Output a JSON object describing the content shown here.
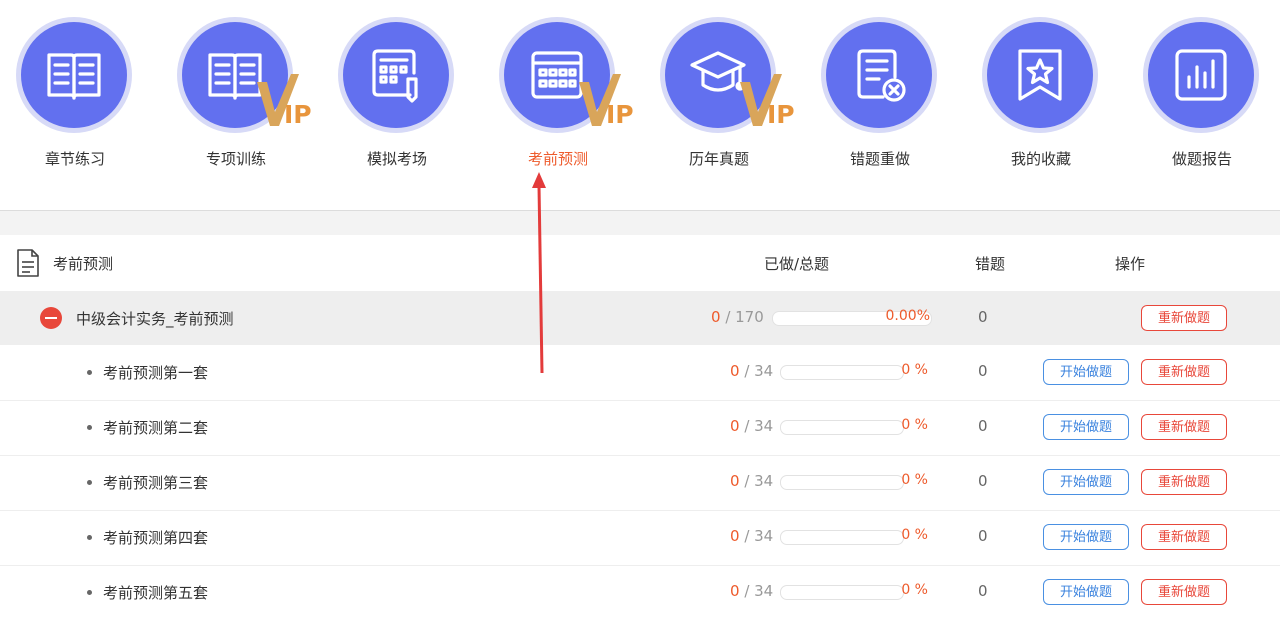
{
  "nav": {
    "items": [
      {
        "id": "chapter",
        "label": "章节练习",
        "icon": "book-icon",
        "vip": false,
        "active": false
      },
      {
        "id": "special",
        "label": "专项训练",
        "icon": "book-icon",
        "vip": true,
        "active": false
      },
      {
        "id": "mock",
        "label": "模拟考场",
        "icon": "exam-paper-icon",
        "vip": false,
        "active": false
      },
      {
        "id": "predict",
        "label": "考前预测",
        "icon": "calendar-grid-icon",
        "vip": true,
        "active": true
      },
      {
        "id": "past",
        "label": "历年真题",
        "icon": "graduation-cap-icon",
        "vip": true,
        "active": false
      },
      {
        "id": "redo",
        "label": "错题重做",
        "icon": "error-doc-icon",
        "vip": false,
        "active": false
      },
      {
        "id": "fav",
        "label": "我的收藏",
        "icon": "star-bookmark-icon",
        "vip": false,
        "active": false
      },
      {
        "id": "report",
        "label": "做题报告",
        "icon": "bar-chart-icon",
        "vip": false,
        "active": false
      }
    ],
    "vip_text": "IP"
  },
  "table": {
    "headers": {
      "name": "考前预测",
      "progress": "已做/总题",
      "wrong": "错题",
      "action": "操作"
    },
    "parent": {
      "name": "中级会计实务_考前预测",
      "done": "0",
      "total": "170",
      "percent": "0.00%",
      "progress": 0,
      "wrong": "0",
      "redo_label": "重新做题"
    },
    "children": [
      {
        "name": "考前预测第一套",
        "done": "0",
        "total": "34",
        "percent": "0 %",
        "progress": 0,
        "wrong": "0",
        "start_label": "开始做题",
        "redo_label": "重新做题"
      },
      {
        "name": "考前预测第二套",
        "done": "0",
        "total": "34",
        "percent": "0 %",
        "progress": 0,
        "wrong": "0",
        "start_label": "开始做题",
        "redo_label": "重新做题"
      },
      {
        "name": "考前预测第三套",
        "done": "0",
        "total": "34",
        "percent": "0 %",
        "progress": 0,
        "wrong": "0",
        "start_label": "开始做题",
        "redo_label": "重新做题"
      },
      {
        "name": "考前预测第四套",
        "done": "0",
        "total": "34",
        "percent": "0 %",
        "progress": 0,
        "wrong": "0",
        "start_label": "开始做题",
        "redo_label": "重新做题"
      },
      {
        "name": "考前预测第五套",
        "done": "0",
        "total": "34",
        "percent": "0 %",
        "progress": 0,
        "wrong": "0",
        "start_label": "开始做题",
        "redo_label": "重新做题"
      }
    ]
  },
  "colors": {
    "accent": "#6270ef",
    "orange": "#ee5b2c",
    "red": "#e8473a",
    "blue": "#3b83de",
    "vip_gold": "#e8953c",
    "arrow": "#e33b3b"
  }
}
